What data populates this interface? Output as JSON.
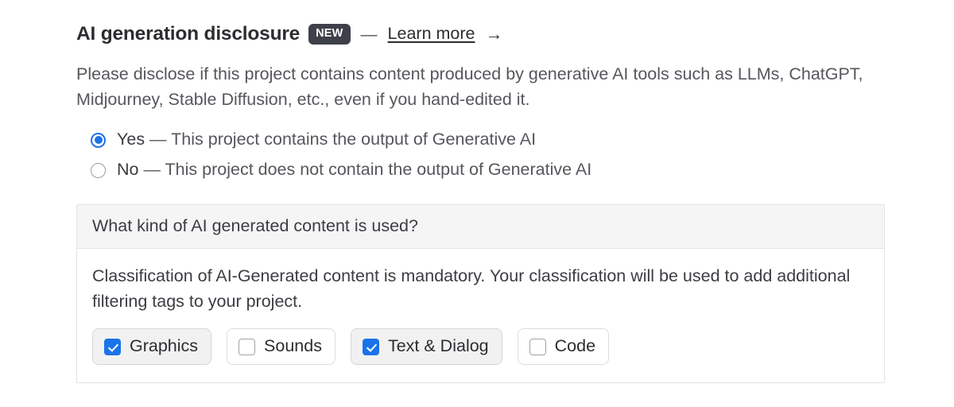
{
  "header": {
    "title": "AI generation disclosure",
    "badge": "NEW",
    "dash": "—",
    "link_text": "Learn more",
    "arrow_icon": "→",
    "badge_bg": "#3d4049",
    "badge_color": "#ffffff"
  },
  "intro": {
    "text": "Please disclose if this project contains content produced by generative AI tools such as LLMs, ChatGPT, Midjourney, Stable Diffusion, etc., even if you hand-edited it."
  },
  "disclosure": {
    "accent_color": "#1d72e8",
    "options": [
      {
        "word": "Yes",
        "separator": " — ",
        "description": "This project contains the output of Generative AI",
        "selected": true
      },
      {
        "word": "No",
        "separator": " — ",
        "description": "This project does not contain the output of Generative AI",
        "selected": false
      }
    ]
  },
  "panel": {
    "header_title": "What kind of AI generated content is used?",
    "header_bg": "#f5f5f6",
    "body_text": "Classification of AI-Generated content is mandatory. Your classification will be used to add additional filtering tags to your project.",
    "checkbox_accent": "#1a73e8",
    "options": [
      {
        "label": "Graphics",
        "checked": true
      },
      {
        "label": "Sounds",
        "checked": false
      },
      {
        "label": "Text & Dialog",
        "checked": true
      },
      {
        "label": "Code",
        "checked": false
      }
    ]
  }
}
